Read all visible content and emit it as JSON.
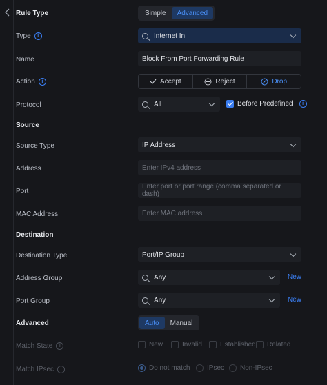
{
  "header": {
    "title": "Rule Type",
    "mode_options": [
      "Simple",
      "Advanced"
    ],
    "mode_selected": "Advanced"
  },
  "type": {
    "label": "Type",
    "value": "Internet In"
  },
  "name": {
    "label": "Name",
    "value": "Block From Port Forwarding Rule"
  },
  "action": {
    "label": "Action",
    "options": [
      "Accept",
      "Reject",
      "Drop"
    ],
    "selected": "Drop"
  },
  "protocol": {
    "label": "Protocol",
    "value": "All",
    "before_predefined_label": "Before Predefined",
    "before_predefined_checked": true
  },
  "source": {
    "section": "Source",
    "type_label": "Source Type",
    "type_value": "IP Address",
    "address_label": "Address",
    "address_placeholder": "Enter IPv4 address",
    "port_label": "Port",
    "port_placeholder": "Enter port or port range (comma separated or dash)",
    "mac_label": "MAC Address",
    "mac_placeholder": "Enter MAC address"
  },
  "destination": {
    "section": "Destination",
    "type_label": "Destination Type",
    "type_value": "Port/IP Group",
    "address_group_label": "Address Group",
    "address_group_value": "Any",
    "address_group_new": "New",
    "port_group_label": "Port Group",
    "port_group_value": "Any",
    "port_group_new": "New"
  },
  "advanced": {
    "section": "Advanced",
    "options": [
      "Auto",
      "Manual"
    ],
    "selected": "Auto",
    "match_state_label": "Match State",
    "match_state_options": [
      "New",
      "Invalid",
      "Established",
      "Related"
    ],
    "match_ipsec_label": "Match IPsec",
    "match_ipsec_options": [
      "Do not match",
      "IPsec",
      "Non-IPsec"
    ],
    "match_ipsec_selected": "Do not match"
  },
  "colors": {
    "accent": "#3a7df0",
    "background": "#16171b",
    "field": "#1e2025"
  }
}
